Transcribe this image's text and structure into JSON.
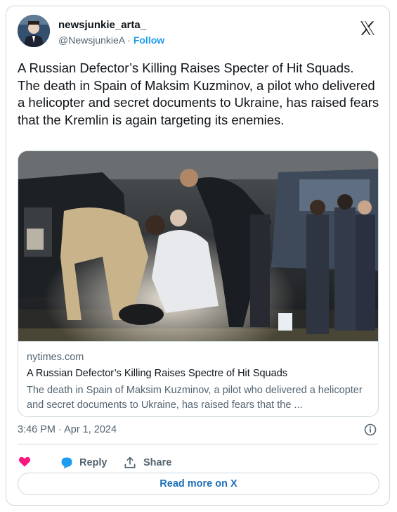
{
  "author": {
    "display_name": "newsjunkie_arta_",
    "handle": "@NewsjunkieA",
    "separator": "·",
    "follow_label": "Follow"
  },
  "tweet": {
    "text": "A Russian Defector’s Killing Raises Specter of Hit Squads. The death in Spain of Maksim Kuzminov, a pilot who delivered a helicopter and secret documents to Ukraine, has raised fears that the Kremlin is again targeting its enemies.",
    "timestamp": "3:46 PM · Apr 1, 2024"
  },
  "link_card": {
    "domain": "nytimes.com",
    "title": "A Russian Defector’s Killing Raises Spectre of Hit Squads",
    "description": "The death in Spain of Maksim Kuzminov, a pilot who delivered a helicopter and secret documents to Ukraine, has raised fears that the ..."
  },
  "actions": {
    "like_icon": "heart-icon",
    "reply_label": "Reply",
    "share_label": "Share"
  },
  "read_more_label": "Read more on X",
  "colors": {
    "accent": "#1d9bf0",
    "heart": "#f91880",
    "border": "#cfd9de",
    "muted": "#536471"
  }
}
